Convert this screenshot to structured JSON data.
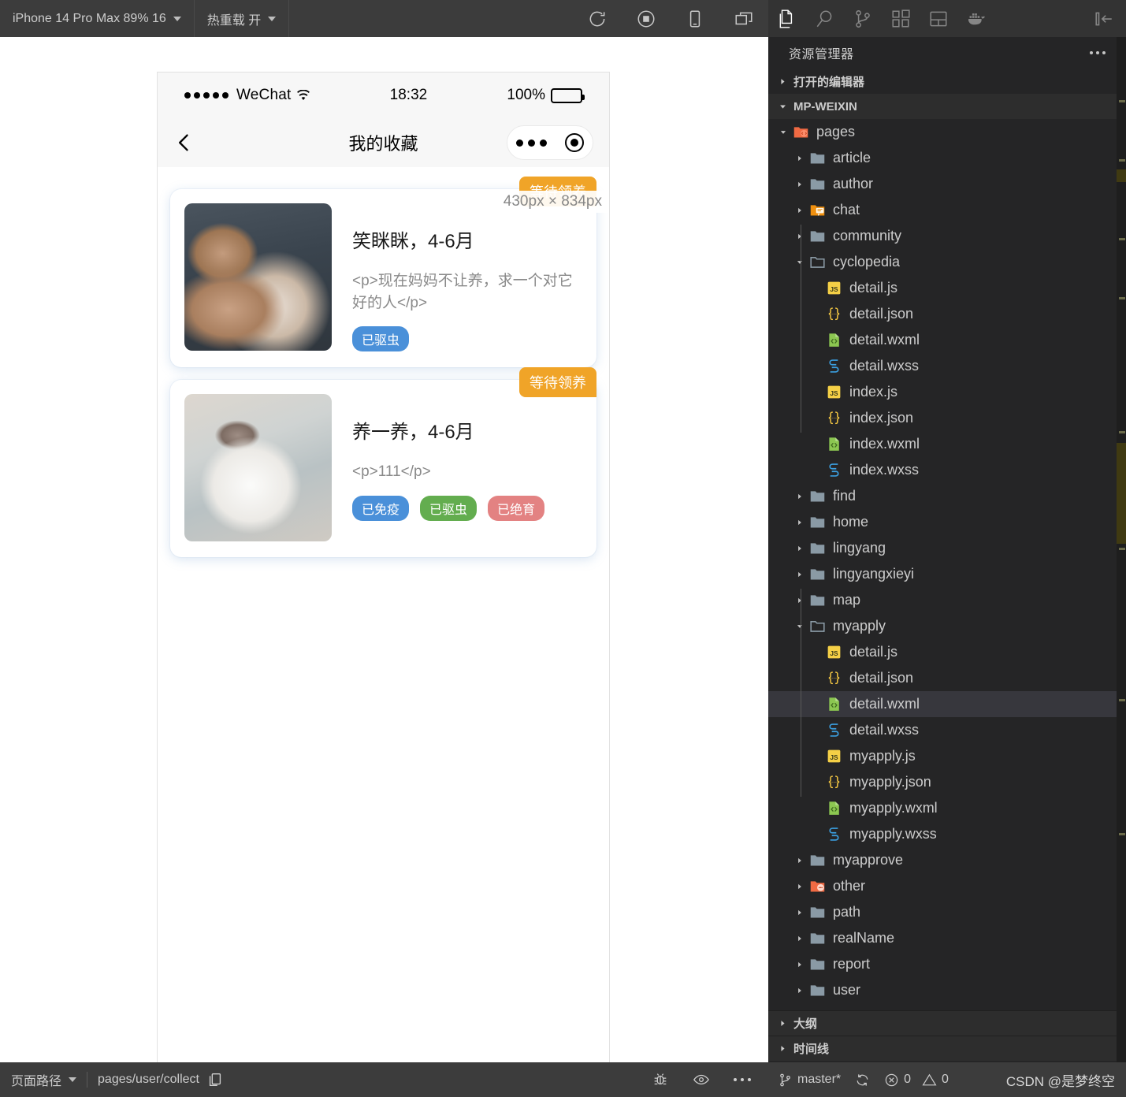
{
  "simulator": {
    "toolbar": {
      "device_label": "iPhone 14 Pro Max 89% 16",
      "hotreload_label": "热重载 开",
      "icons": [
        "refresh-icon",
        "stop-record-icon",
        "device-icon",
        "multi-window-icon"
      ]
    },
    "phone": {
      "status_bar": {
        "carrier": "WeChat",
        "time": "18:32",
        "battery_percent": "100%"
      },
      "nav": {
        "title": "我的收藏",
        "back_icon": "chevron-left-icon",
        "capsule_more": "more-dots-icon",
        "capsule_target": "target-icon"
      },
      "dimension_badge": "430px × 834px",
      "cards": [
        {
          "ribbon": "等待领养",
          "title": "笑眯眯，4-6月",
          "desc": "<p>现在妈妈不让养，求一个对它好的人</p>",
          "thumb": "bear-cat-photo",
          "tags": [
            {
              "label": "已驱虫",
              "color": "#4a90d9"
            }
          ]
        },
        {
          "ribbon": "等待领养",
          "title": "养一养，4-6月",
          "desc": "<p>111</p>",
          "thumb": "white-cat-photo",
          "tags": [
            {
              "label": "已免疫",
              "color": "#4a90d9"
            },
            {
              "label": "已驱虫",
              "color": "#63ad4f"
            },
            {
              "label": "已绝育",
              "color": "#e38282"
            }
          ]
        }
      ]
    },
    "status_bar": {
      "page_path_label": "页面路径",
      "page_path_value": "pages/user/collect",
      "copy_icon": "copy-icon",
      "icons": [
        "bug-icon",
        "eye-icon",
        "more-dots-icon"
      ]
    }
  },
  "vscode": {
    "activity_bar": [
      {
        "name": "explorer-icon",
        "active": true
      },
      {
        "name": "search-icon",
        "active": false
      },
      {
        "name": "source-control-icon",
        "active": false
      },
      {
        "name": "extensions-icon",
        "active": false
      },
      {
        "name": "layout-panel-icon",
        "active": false
      },
      {
        "name": "docker-icon",
        "active": false
      }
    ],
    "collapse_icon": "collapse-sidebar-icon",
    "panel_title": "资源管理器",
    "more_actions": "more-actions-icon",
    "sections": {
      "open_editors": "打开的编辑器",
      "workspace": "MP-WEIXIN",
      "outline": "大纲",
      "timeline": "时间线"
    },
    "tree": [
      {
        "label": "pages",
        "depth": 1,
        "type": "folder",
        "state": "open",
        "icon": "folder-pages"
      },
      {
        "label": "article",
        "depth": 2,
        "type": "folder",
        "state": "closed",
        "icon": "folder-plain"
      },
      {
        "label": "author",
        "depth": 2,
        "type": "folder",
        "state": "closed",
        "icon": "folder-plain"
      },
      {
        "label": "chat",
        "depth": 2,
        "type": "folder",
        "state": "closed",
        "icon": "folder-chat"
      },
      {
        "label": "community",
        "depth": 2,
        "type": "folder",
        "state": "closed",
        "icon": "folder-plain"
      },
      {
        "label": "cyclopedia",
        "depth": 2,
        "type": "folder",
        "state": "open",
        "icon": "folder-plain-open"
      },
      {
        "label": "detail.js",
        "depth": 3,
        "type": "file",
        "icon": "js"
      },
      {
        "label": "detail.json",
        "depth": 3,
        "type": "file",
        "icon": "json"
      },
      {
        "label": "detail.wxml",
        "depth": 3,
        "type": "file",
        "icon": "wxml"
      },
      {
        "label": "detail.wxss",
        "depth": 3,
        "type": "file",
        "icon": "wxss"
      },
      {
        "label": "index.js",
        "depth": 3,
        "type": "file",
        "icon": "js"
      },
      {
        "label": "index.json",
        "depth": 3,
        "type": "file",
        "icon": "json"
      },
      {
        "label": "index.wxml",
        "depth": 3,
        "type": "file",
        "icon": "wxml"
      },
      {
        "label": "index.wxss",
        "depth": 3,
        "type": "file",
        "icon": "wxss"
      },
      {
        "label": "find",
        "depth": 2,
        "type": "folder",
        "state": "closed",
        "icon": "folder-plain"
      },
      {
        "label": "home",
        "depth": 2,
        "type": "folder",
        "state": "closed",
        "icon": "folder-plain"
      },
      {
        "label": "lingyang",
        "depth": 2,
        "type": "folder",
        "state": "closed",
        "icon": "folder-plain"
      },
      {
        "label": "lingyangxieyi",
        "depth": 2,
        "type": "folder",
        "state": "closed",
        "icon": "folder-plain"
      },
      {
        "label": "map",
        "depth": 2,
        "type": "folder",
        "state": "closed",
        "icon": "folder-plain"
      },
      {
        "label": "myapply",
        "depth": 2,
        "type": "folder",
        "state": "open",
        "icon": "folder-plain-open"
      },
      {
        "label": "detail.js",
        "depth": 3,
        "type": "file",
        "icon": "js"
      },
      {
        "label": "detail.json",
        "depth": 3,
        "type": "file",
        "icon": "json"
      },
      {
        "label": "detail.wxml",
        "depth": 3,
        "type": "file",
        "icon": "wxml",
        "selected": true
      },
      {
        "label": "detail.wxss",
        "depth": 3,
        "type": "file",
        "icon": "wxss"
      },
      {
        "label": "myapply.js",
        "depth": 3,
        "type": "file",
        "icon": "js"
      },
      {
        "label": "myapply.json",
        "depth": 3,
        "type": "file",
        "icon": "json"
      },
      {
        "label": "myapply.wxml",
        "depth": 3,
        "type": "file",
        "icon": "wxml"
      },
      {
        "label": "myapply.wxss",
        "depth": 3,
        "type": "file",
        "icon": "wxss"
      },
      {
        "label": "myapprove",
        "depth": 2,
        "type": "folder",
        "state": "closed",
        "icon": "folder-plain"
      },
      {
        "label": "other",
        "depth": 2,
        "type": "folder",
        "state": "closed",
        "icon": "folder-other"
      },
      {
        "label": "path",
        "depth": 2,
        "type": "folder",
        "state": "closed",
        "icon": "folder-plain"
      },
      {
        "label": "realName",
        "depth": 2,
        "type": "folder",
        "state": "closed",
        "icon": "folder-plain"
      },
      {
        "label": "report",
        "depth": 2,
        "type": "folder",
        "state": "closed",
        "icon": "folder-plain"
      },
      {
        "label": "user",
        "depth": 2,
        "type": "folder",
        "state": "closed",
        "icon": "folder-plain"
      }
    ],
    "status_bar": {
      "branch": "master*",
      "branch_icon": "source-control-icon",
      "sync_icon": "sync-icon",
      "errors": "0",
      "warnings": "0",
      "watermark": "CSDN @是梦终空"
    }
  }
}
